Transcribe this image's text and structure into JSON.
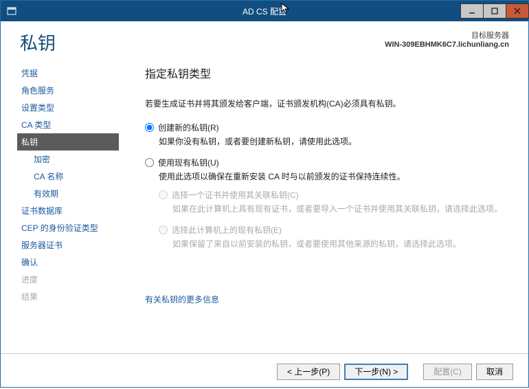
{
  "titlebar": {
    "title": "AD CS 配置"
  },
  "header": {
    "page_title": "私钥",
    "target_label": "目标服务器",
    "target_server": "WIN-309EBHMK6C7.lichunliang.cn"
  },
  "sidebar": {
    "items": [
      {
        "label": "凭据"
      },
      {
        "label": "角色服务"
      },
      {
        "label": "设置类型"
      },
      {
        "label": "CA 类型"
      },
      {
        "label": "私钥",
        "selected": true
      },
      {
        "label": "加密",
        "sub": true
      },
      {
        "label": "CA 名称",
        "sub": true
      },
      {
        "label": "有效期",
        "sub": true
      },
      {
        "label": "证书数据库"
      },
      {
        "label": "CEP 的身份验证类型"
      },
      {
        "label": "服务器证书"
      },
      {
        "label": "确认"
      },
      {
        "label": "进度",
        "disabled": true
      },
      {
        "label": "结果",
        "disabled": true
      }
    ]
  },
  "content": {
    "heading": "指定私钥类型",
    "instruction": "若要生成证书并将其颁发给客户端，证书颁发机构(CA)必须具有私钥。",
    "options": {
      "create": {
        "label": "创建新的私钥(R)",
        "desc": "如果你没有私钥，或者要创建新私钥，请使用此选项。"
      },
      "use_existing": {
        "label": "使用现有私钥(U)",
        "desc": "使用此选项以确保在重新安装 CA 时与以前颁发的证书保持连续性。",
        "sub1": {
          "label": "选择一个证书并使用其关联私钥(C)",
          "desc": "如果在此计算机上具有现有证书，或者要导入一个证书并使用其关联私钥，请选择此选项。"
        },
        "sub2": {
          "label": "选择此计算机上的现有私钥(E)",
          "desc": "如果保留了来自以前安装的私钥，或者要使用其他来源的私钥，请选择此选项。"
        }
      }
    },
    "more_link": "有关私钥的更多信息"
  },
  "footer": {
    "prev": "< 上一步(P)",
    "next": "下一步(N) >",
    "configure": "配置(C)",
    "cancel": "取消"
  }
}
